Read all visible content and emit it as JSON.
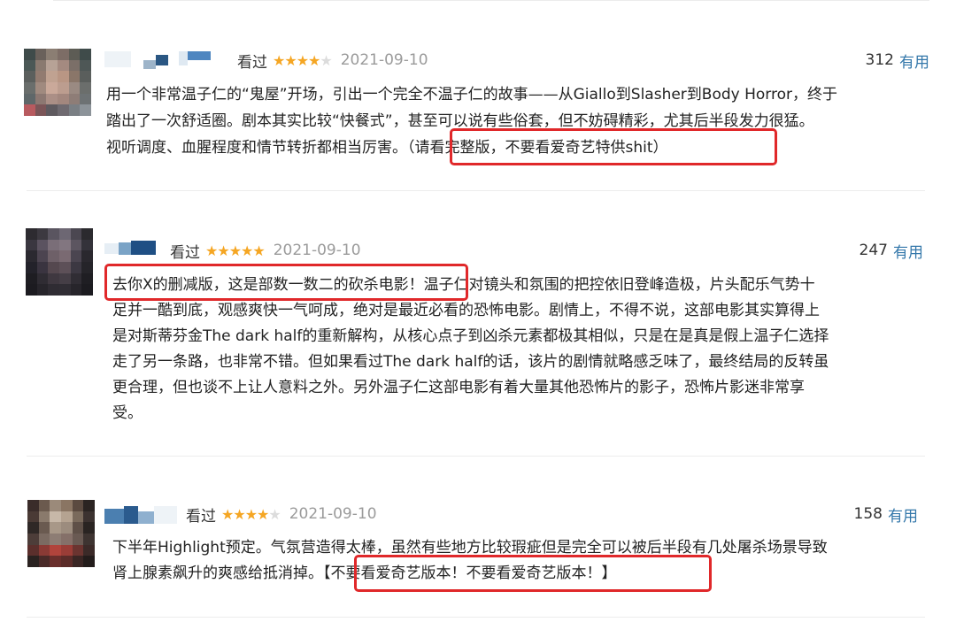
{
  "comments": [
    {
      "watched_label": "看过",
      "rating": 4,
      "date": "2021-09-10",
      "vote_count": "312",
      "useful_label": "有用",
      "lines": [
        "用一个非常温子仁的“鬼屋”开场，引出一个完全不温子仁的故事——从Giallo到Slasher到Body Horror，终于",
        "踏出了一次舒适圈。剧本其实比较“快餐式”，甚至可以说有些俗套，但不妨碍精彩，尤其后半段发力很猛。",
        "视听调度、血腥程度和情节转折都相当厉害。（请看完整版，不要看爱奇艺特供shit）"
      ]
    },
    {
      "watched_label": "看过",
      "rating": 5,
      "date": "2021-09-10",
      "vote_count": "247",
      "useful_label": "有用",
      "lines": [
        "去你X的删减版，这是部数一数二的砍杀电影！温子仁对镜头和氛围的把控依旧登峰造极，片头配乐气势十",
        "足并一酷到底，观感爽快一气呵成，绝对是最近必看的恐怖电影。剧情上，不得不说，这部电影其实算得上",
        "是对斯蒂芬金The dark half的重新解构，从核心点子到凶杀元素都极其相似，只是在是真是假上温子仁选择",
        "走了另一条路，也非常不错。但如果看过The dark half的话，该片的剧情就略感乏味了，最终结局的反转虽",
        "更合理，但也谈不上让人意料之外。另外温子仁这部电影有着大量其他恐怖片的影子，恐怖片影迷非常享",
        "受。"
      ]
    },
    {
      "watched_label": "看过",
      "rating": 4,
      "date": "2021-09-10",
      "vote_count": "158",
      "useful_label": "有用",
      "lines": [
        "下半年Highlight预定。气氛营造得太棒，虽然有些地方比较瑕疵但是完全可以被后半段有几处屠杀场景导致",
        "肾上腺素飙升的爽感给抵消掉。【不要看爱奇艺版本！不要看爱奇艺版本！】"
      ]
    }
  ],
  "colors": {
    "highlight_box": "#e0282a",
    "useful_link": "#3377aa",
    "star": "#f5a623",
    "date": "#9b9b9b"
  }
}
